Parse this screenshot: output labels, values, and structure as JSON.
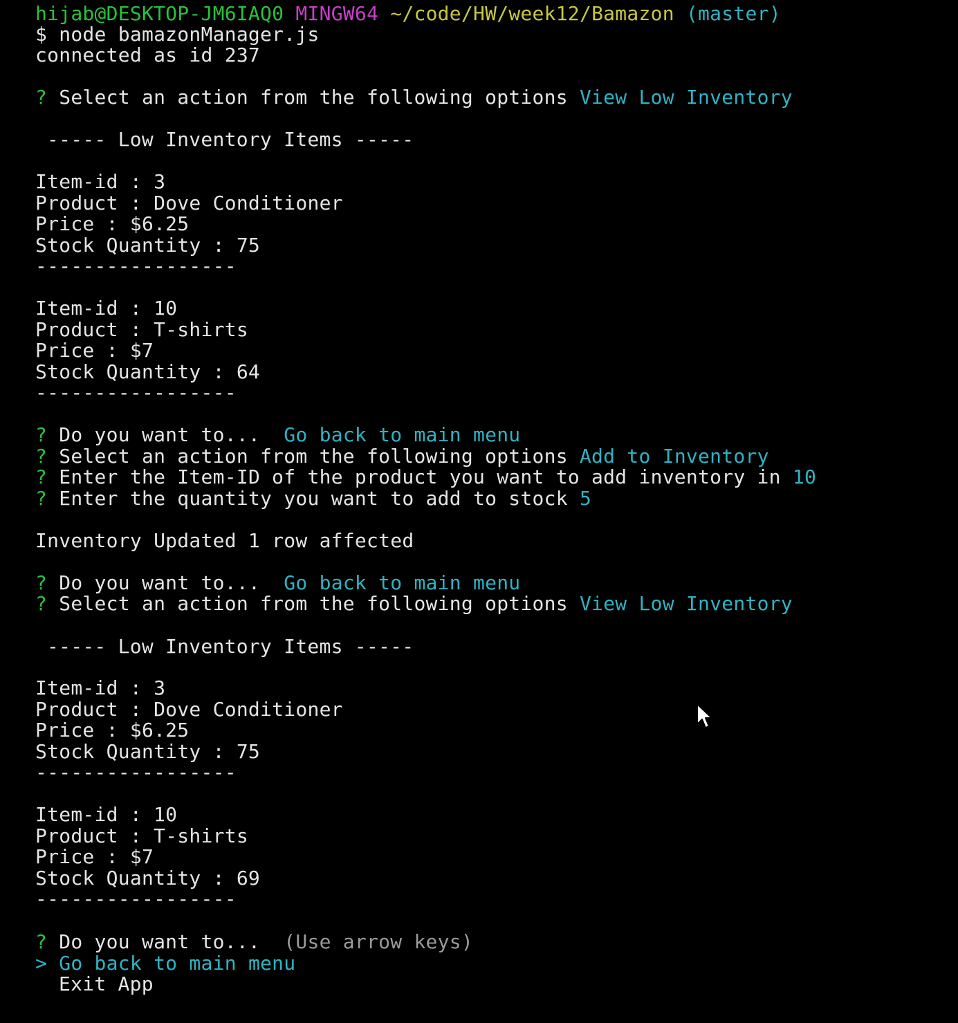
{
  "prompt": {
    "user_host": "hijab@DESKTOP-JM6IAQ0",
    "shell": "MINGW64",
    "path": "~/code/HW/week12/Bamazon",
    "branch": "(master)"
  },
  "command": "$ node bamazonManager.js",
  "connected": "connected as id 237",
  "q_mark": "?",
  "q_select": "Select an action from the following options",
  "q_do_you_want": "Do you want to...",
  "q_enter_item_id": "Enter the Item-ID of the product you want to add inventory in",
  "q_enter_quantity": "Enter the quantity you want to add to stock",
  "answers": {
    "view_low_inventory": "View Low Inventory",
    "go_back": "Go back to main menu",
    "add_to_inventory": "Add to Inventory",
    "item_id": "10",
    "quantity": "5"
  },
  "low_inventory_header": "----- Low Inventory Items -----",
  "separator": "-----------------",
  "update_message": "Inventory Updated 1 row affected",
  "first_listing": [
    {
      "item_id": "Item-id : 3",
      "product": "Product : Dove Conditioner",
      "price": "Price : $6.25",
      "stock": "Stock Quantity : 75"
    },
    {
      "item_id": "Item-id : 10",
      "product": "Product : T-shirts",
      "price": "Price : $7",
      "stock": "Stock Quantity : 64"
    }
  ],
  "second_listing": [
    {
      "item_id": "Item-id : 3",
      "product": "Product : Dove Conditioner",
      "price": "Price : $6.25",
      "stock": "Stock Quantity : 75"
    },
    {
      "item_id": "Item-id : 10",
      "product": "Product : T-shirts",
      "price": "Price : $7",
      "stock": "Stock Quantity : 69"
    }
  ],
  "final_menu": {
    "hint": "(Use arrow keys)",
    "pointer": ">",
    "selected_option": "Go back to main menu",
    "other_option": "Exit App"
  },
  "colors": {
    "background": "#000000",
    "text": "#e4e4e4",
    "green": "#27c23c",
    "purple": "#c63fc6",
    "yellow": "#c8c83c",
    "cyan": "#2fb3c4"
  }
}
